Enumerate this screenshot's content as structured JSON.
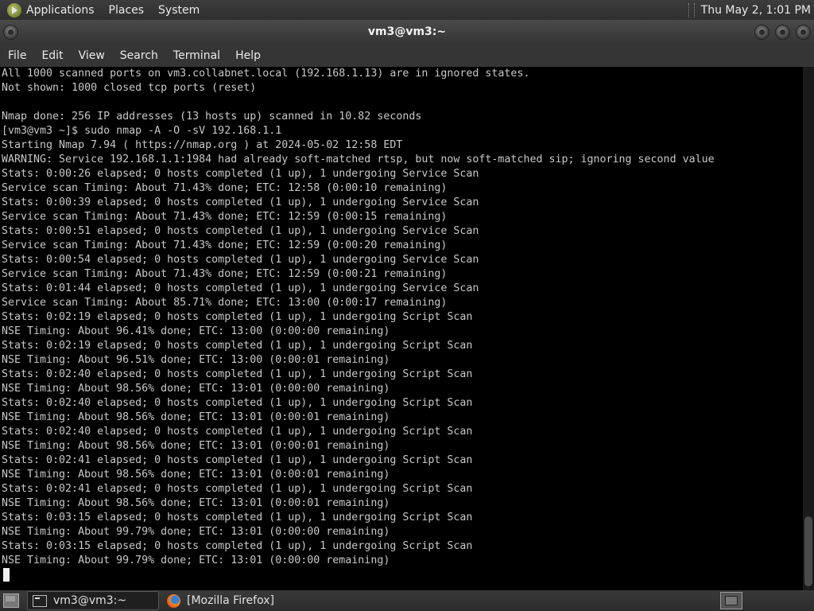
{
  "top_panel": {
    "menus": [
      "Applications",
      "Places",
      "System"
    ],
    "clock": "Thu May 2,  1:01 PM"
  },
  "window": {
    "title": "vm3@vm3:~"
  },
  "menubar": [
    "File",
    "Edit",
    "View",
    "Search",
    "Terminal",
    "Help"
  ],
  "terminal": {
    "lines": [
      "All 1000 scanned ports on vm3.collabnet.local (192.168.1.13) are in ignored states.",
      "Not shown: 1000 closed tcp ports (reset)",
      "",
      "Nmap done: 256 IP addresses (13 hosts up) scanned in 10.82 seconds",
      "[vm3@vm3 ~]$ sudo nmap -A -O -sV 192.168.1.1",
      "Starting Nmap 7.94 ( https://nmap.org ) at 2024-05-02 12:58 EDT",
      "WARNING: Service 192.168.1.1:1984 had already soft-matched rtsp, but now soft-matched sip; ignoring second value",
      "Stats: 0:00:26 elapsed; 0 hosts completed (1 up), 1 undergoing Service Scan",
      "Service scan Timing: About 71.43% done; ETC: 12:58 (0:00:10 remaining)",
      "Stats: 0:00:39 elapsed; 0 hosts completed (1 up), 1 undergoing Service Scan",
      "Service scan Timing: About 71.43% done; ETC: 12:59 (0:00:15 remaining)",
      "Stats: 0:00:51 elapsed; 0 hosts completed (1 up), 1 undergoing Service Scan",
      "Service scan Timing: About 71.43% done; ETC: 12:59 (0:00:20 remaining)",
      "Stats: 0:00:54 elapsed; 0 hosts completed (1 up), 1 undergoing Service Scan",
      "Service scan Timing: About 71.43% done; ETC: 12:59 (0:00:21 remaining)",
      "Stats: 0:01:44 elapsed; 0 hosts completed (1 up), 1 undergoing Service Scan",
      "Service scan Timing: About 85.71% done; ETC: 13:00 (0:00:17 remaining)",
      "Stats: 0:02:19 elapsed; 0 hosts completed (1 up), 1 undergoing Script Scan",
      "NSE Timing: About 96.41% done; ETC: 13:00 (0:00:00 remaining)",
      "Stats: 0:02:19 elapsed; 0 hosts completed (1 up), 1 undergoing Script Scan",
      "NSE Timing: About 96.51% done; ETC: 13:00 (0:00:01 remaining)",
      "Stats: 0:02:40 elapsed; 0 hosts completed (1 up), 1 undergoing Script Scan",
      "NSE Timing: About 98.56% done; ETC: 13:01 (0:00:00 remaining)",
      "Stats: 0:02:40 elapsed; 0 hosts completed (1 up), 1 undergoing Script Scan",
      "NSE Timing: About 98.56% done; ETC: 13:01 (0:00:01 remaining)",
      "Stats: 0:02:40 elapsed; 0 hosts completed (1 up), 1 undergoing Script Scan",
      "NSE Timing: About 98.56% done; ETC: 13:01 (0:00:01 remaining)",
      "Stats: 0:02:41 elapsed; 0 hosts completed (1 up), 1 undergoing Script Scan",
      "NSE Timing: About 98.56% done; ETC: 13:01 (0:00:01 remaining)",
      "Stats: 0:02:41 elapsed; 0 hosts completed (1 up), 1 undergoing Script Scan",
      "NSE Timing: About 98.56% done; ETC: 13:01 (0:00:01 remaining)",
      "Stats: 0:03:15 elapsed; 0 hosts completed (1 up), 1 undergoing Script Scan",
      "NSE Timing: About 99.79% done; ETC: 13:01 (0:00:00 remaining)",
      "Stats: 0:03:15 elapsed; 0 hosts completed (1 up), 1 undergoing Script Scan",
      "NSE Timing: About 99.79% done; ETC: 13:01 (0:00:00 remaining)"
    ]
  },
  "taskbar": {
    "tasks": [
      {
        "label": "vm3@vm3:~",
        "icon": "terminal-icon",
        "active": true
      },
      {
        "label": "[Mozilla Firefox]",
        "icon": "firefox-icon",
        "active": false
      }
    ]
  },
  "colors": {
    "terminal_bg": "#000000",
    "terminal_fg": "#c8c8c8",
    "panel_bg": "#353535"
  }
}
